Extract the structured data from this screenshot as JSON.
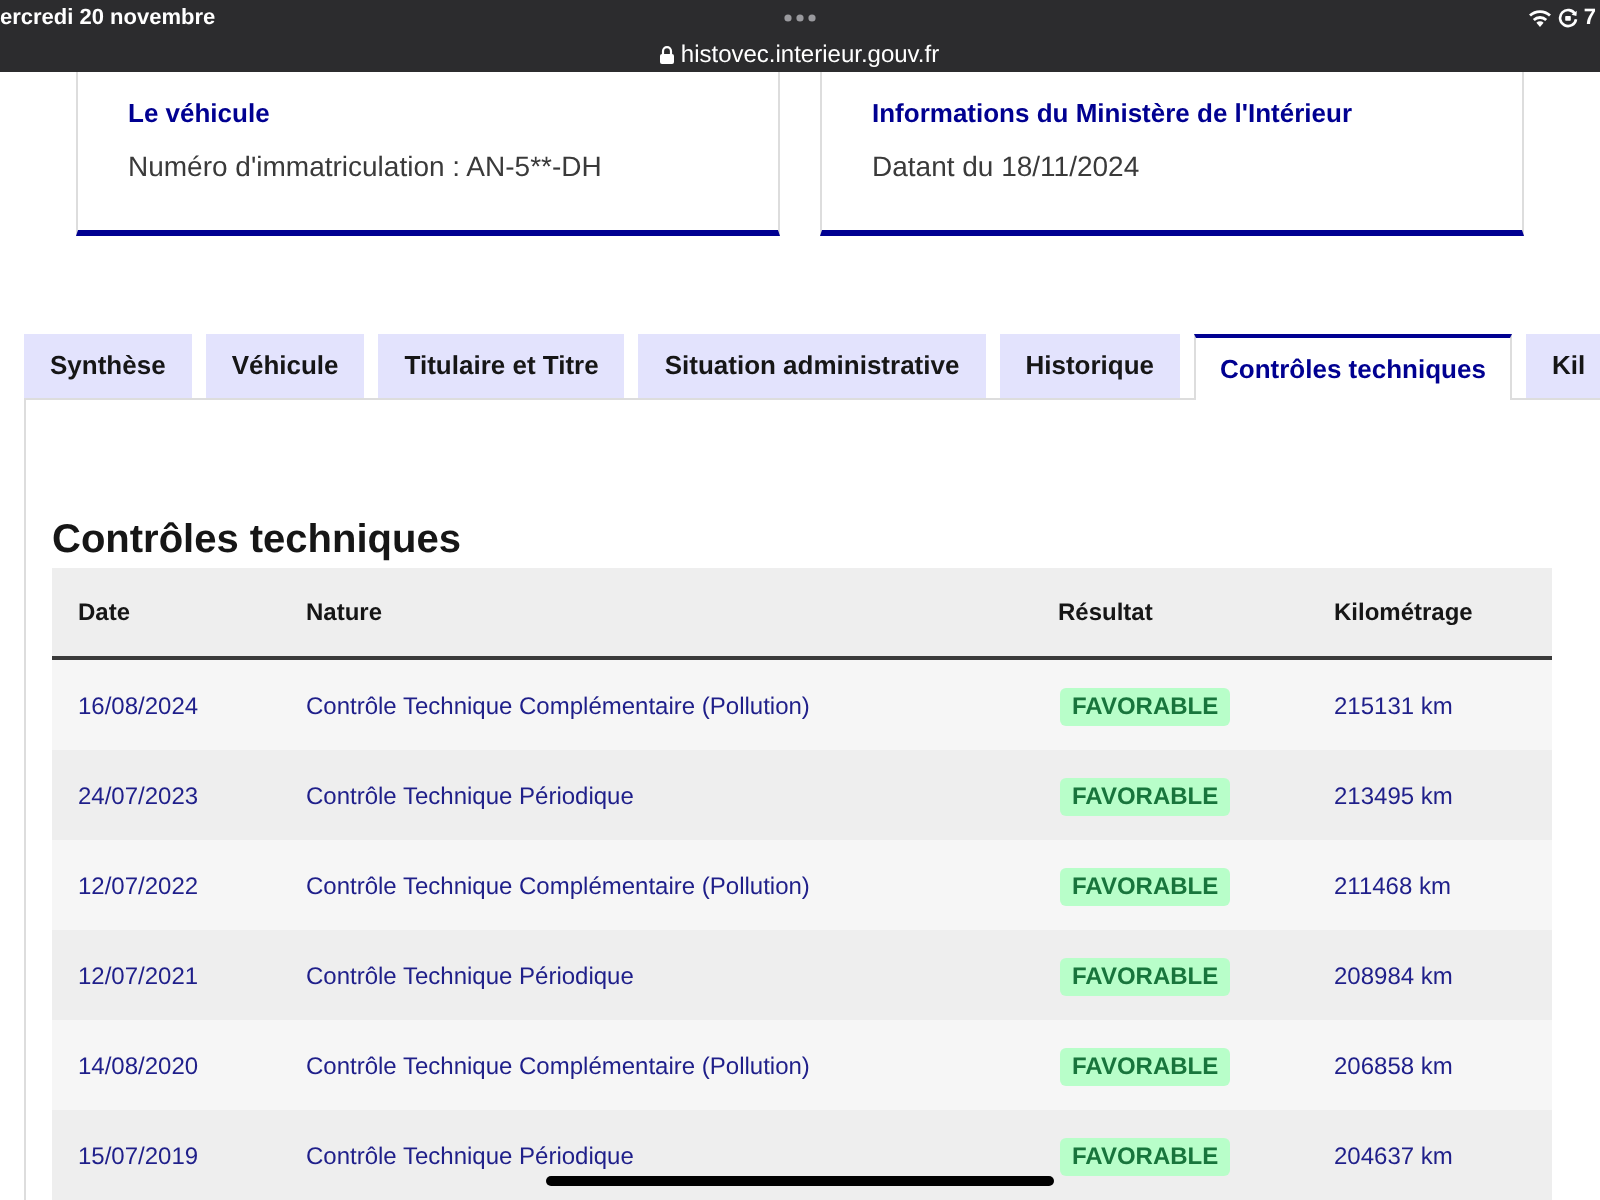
{
  "status_bar": {
    "date": "ercredi 20 novembre",
    "url": "histovec.interieur.gouv.fr",
    "battery": "7"
  },
  "cards": [
    {
      "title": "Le véhicule",
      "text": "Numéro d'immatriculation : AN-5**-DH"
    },
    {
      "title": "Informations du Ministère de l'Intérieur",
      "text": "Datant du 18/11/2024"
    }
  ],
  "tabs": [
    {
      "label": "Synthèse",
      "selected": false
    },
    {
      "label": "Véhicule",
      "selected": false
    },
    {
      "label": "Titulaire et Titre",
      "selected": false
    },
    {
      "label": "Situation administrative",
      "selected": false
    },
    {
      "label": "Historique",
      "selected": false
    },
    {
      "label": "Contrôles techniques",
      "selected": true
    },
    {
      "label": "Kil",
      "selected": false
    }
  ],
  "section_title": "Contrôles techniques",
  "table": {
    "columns": [
      "Date",
      "Nature",
      "Résultat",
      "Kilométrage"
    ],
    "rows": [
      {
        "date": "16/08/2024",
        "nature": "Contrôle Technique Complémentaire (Pollution)",
        "result": "FAVORABLE",
        "mileage": "215131 km"
      },
      {
        "date": "24/07/2023",
        "nature": "Contrôle Technique Périodique",
        "result": "FAVORABLE",
        "mileage": "213495 km"
      },
      {
        "date": "12/07/2022",
        "nature": "Contrôle Technique Complémentaire (Pollution)",
        "result": "FAVORABLE",
        "mileage": "211468 km"
      },
      {
        "date": "12/07/2021",
        "nature": "Contrôle Technique Périodique",
        "result": "FAVORABLE",
        "mileage": "208984 km"
      },
      {
        "date": "14/08/2020",
        "nature": "Contrôle Technique Complémentaire (Pollution)",
        "result": "FAVORABLE",
        "mileage": "206858 km"
      },
      {
        "date": "15/07/2019",
        "nature": "Contrôle Technique Périodique",
        "result": "FAVORABLE",
        "mileage": "204637 km"
      }
    ]
  }
}
